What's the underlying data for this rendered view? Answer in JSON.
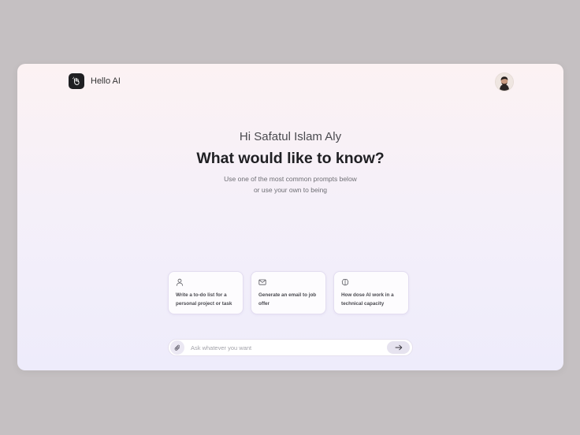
{
  "app": {
    "name": "Hello AI",
    "logo_icon": "waving-hand-icon"
  },
  "header": {
    "avatar_icon": "user-avatar"
  },
  "hero": {
    "greeting": "Hi Safatul Islam Aly",
    "headline": "What would like to know?",
    "subtitle_line1": "Use one of the most common prompts below",
    "subtitle_line2": "or use your own to being"
  },
  "prompt_cards": [
    {
      "icon": "user-icon",
      "text": "Write a to-do list for a personal project or task"
    },
    {
      "icon": "mail-icon",
      "text": "Generate an email to job offer"
    },
    {
      "icon": "brain-icon",
      "text": "How dose AI work in a technical capacity"
    }
  ],
  "prompt_bar": {
    "placeholder": "Ask whatever you want",
    "value": "",
    "attach_icon": "paperclip-icon",
    "send_icon": "arrow-right-icon"
  },
  "colors": {
    "page_background": "#c5c0c2",
    "logo_background": "#1f1f22",
    "heading_text": "#1f1f23"
  }
}
